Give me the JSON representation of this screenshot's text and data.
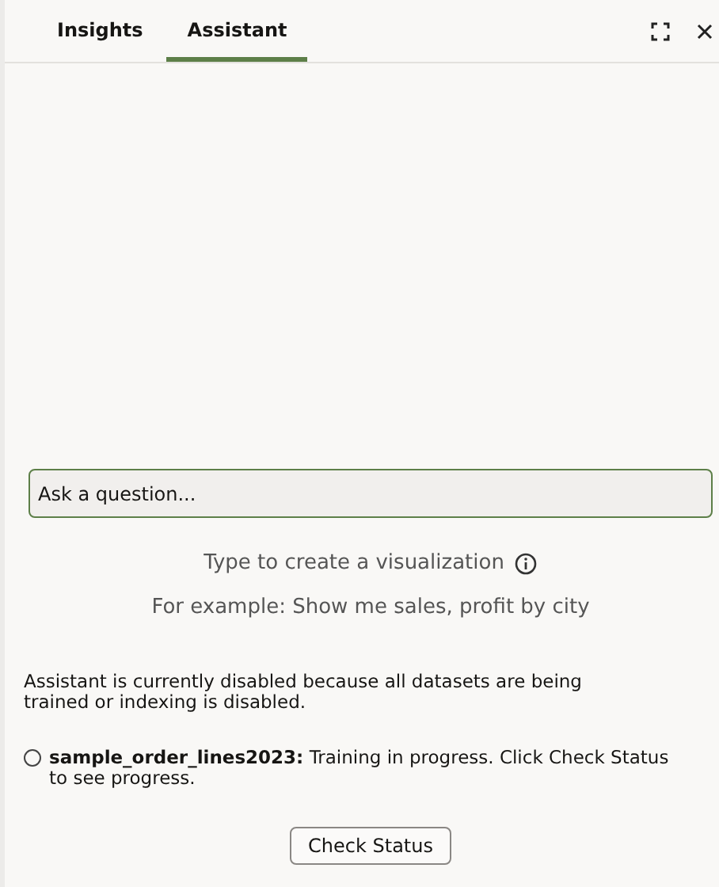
{
  "tabs": [
    {
      "label": "Insights",
      "selected": false
    },
    {
      "label": "Assistant",
      "selected": true
    }
  ],
  "question": {
    "placeholder": "Ask a question..."
  },
  "hint": "Type to create a visualization",
  "example": "For example: Show me sales, profit by city",
  "notice": "Assistant is currently disabled because all datasets are being trained or indexing is disabled.",
  "datasets": [
    {
      "text": "**sample_order_lines2023:** Training in progress. Click Check Status to see progress.",
      "selected": false
    }
  ],
  "button": "Check Status"
}
